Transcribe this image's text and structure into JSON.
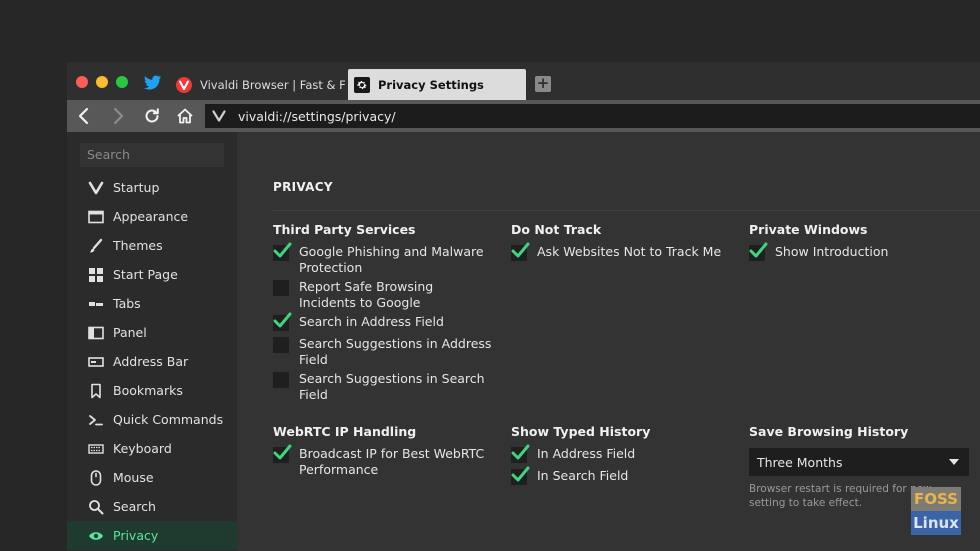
{
  "tabs": [
    {
      "label": "Vivaldi Browser | Fast & Flexible"
    },
    {
      "label": "Privacy Settings"
    }
  ],
  "address_bar": {
    "url": "vivaldi://settings/privacy/"
  },
  "sidebar": {
    "search_placeholder": "Search",
    "items": [
      {
        "label": "Startup",
        "icon": "vivaldi-logo-icon"
      },
      {
        "label": "Appearance",
        "icon": "window-icon"
      },
      {
        "label": "Themes",
        "icon": "brush-icon"
      },
      {
        "label": "Start Page",
        "icon": "grid-icon"
      },
      {
        "label": "Tabs",
        "icon": "tabs-icon"
      },
      {
        "label": "Panel",
        "icon": "panel-icon"
      },
      {
        "label": "Address Bar",
        "icon": "address-bar-icon"
      },
      {
        "label": "Bookmarks",
        "icon": "bookmark-icon"
      },
      {
        "label": "Quick Commands",
        "icon": "command-icon"
      },
      {
        "label": "Keyboard",
        "icon": "keyboard-icon"
      },
      {
        "label": "Mouse",
        "icon": "mouse-icon"
      },
      {
        "label": "Search",
        "icon": "search-icon"
      },
      {
        "label": "Privacy",
        "icon": "eye-icon",
        "active": true
      }
    ]
  },
  "content": {
    "section_title": "PRIVACY",
    "third_party": {
      "title": "Third Party Services",
      "options": [
        {
          "label": "Google Phishing and Malware Protection",
          "checked": true
        },
        {
          "label": "Report Safe Browsing Incidents to Google",
          "checked": false
        },
        {
          "label": "Search in Address Field",
          "checked": true
        },
        {
          "label": "Search Suggestions in Address Field",
          "checked": false
        },
        {
          "label": "Search Suggestions in Search Field",
          "checked": false
        }
      ]
    },
    "do_not_track": {
      "title": "Do Not Track",
      "options": [
        {
          "label": "Ask Websites Not to Track Me",
          "checked": true
        }
      ]
    },
    "private_windows": {
      "title": "Private Windows",
      "options": [
        {
          "label": "Show Introduction",
          "checked": true
        }
      ]
    },
    "webrtc": {
      "title": "WebRTC IP Handling",
      "options": [
        {
          "label": "Broadcast IP for Best WebRTC Performance",
          "checked": true
        }
      ]
    },
    "typed_history": {
      "title": "Show Typed History",
      "options": [
        {
          "label": "In Address Field",
          "checked": true
        },
        {
          "label": "In Search Field",
          "checked": true
        }
      ]
    },
    "browsing_history": {
      "title": "Save Browsing History",
      "selected": "Three Months",
      "hint": "Browser restart is required for new setting to take effect."
    }
  },
  "watermark": {
    "top": "FOSS",
    "bottom": "Linux"
  },
  "colors": {
    "accent": "#5de69a",
    "check": "#3fd57f"
  }
}
